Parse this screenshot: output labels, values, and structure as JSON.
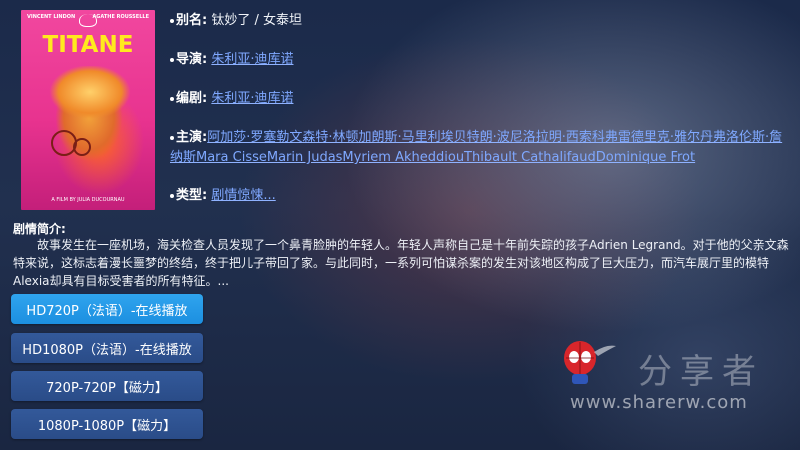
{
  "poster": {
    "title": "TITANE",
    "credit_left": "VINCENT LINDON",
    "credit_right": "AGATHE ROUSSELLE",
    "byline": "A FILM BY JULIA DUCOURNAU"
  },
  "info": {
    "alias_label": "别名:",
    "alias_value": "钛妙了 / 女泰坦",
    "director_label": "导演:",
    "director_value": "朱利亚·迪库诺",
    "writer_label": "编剧:",
    "writer_value": "朱利亚·迪库诺",
    "cast_label": "主演:",
    "cast_value": "阿加莎·罗塞勒文森特·林顿加朗斯·马里利埃贝特朗·波尼洛拉明·西索科弗雷德里克·雅尔丹弗洛伦斯·詹纳斯Mara CisseMarin JudasMyriem AkheddiouThibault CathalifaudDominique Frot",
    "genre_label": "类型:",
    "genre_value": "剧情惊悚..."
  },
  "synopsis": {
    "label": "剧情简介:",
    "text": "故事发生在一座机场，海关检查人员发现了一个鼻青脸肿的年轻人。年轻人声称自己是十年前失踪的孩子Adrien Legrand。对于他的父亲文森特来说，这标志着漫长噩梦的终结，终于把儿子带回了家。与此同时，一系列可怕谋杀案的发生对该地区构成了巨大压力，而汽车展厅里的模特Alexia却具有目标受害者的所有特征。..."
  },
  "buttons": [
    {
      "label": "HD720P（法语）-在线播放"
    },
    {
      "label": "HD1080P（法语）-在线播放"
    },
    {
      "label": "720P-720P【磁力】"
    },
    {
      "label": "1080P-1080P【磁力】"
    }
  ],
  "watermark": {
    "text": "分享者",
    "url": "www.sharerw.com"
  },
  "colors": {
    "link": "#7fa8ff",
    "button_active": "#1c8fe0",
    "button": "#2a4c88"
  }
}
